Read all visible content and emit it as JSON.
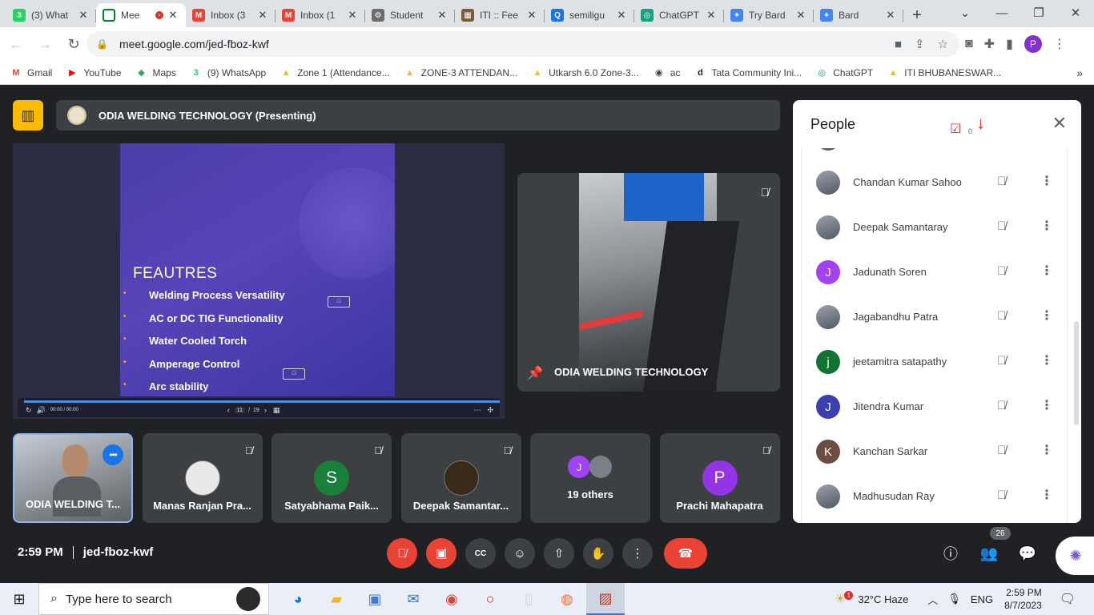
{
  "browser": {
    "tabs": [
      {
        "label": "(3) What",
        "icon": "whatsapp-icon",
        "color": "#25d366",
        "badge": "3"
      },
      {
        "label": "Mee",
        "icon": "meet-icon",
        "color": "#00832d",
        "active": true,
        "recording": true
      },
      {
        "label": "Inbox (3",
        "icon": "gmail-icon",
        "color": "#ea4335",
        "badge": "M"
      },
      {
        "label": "Inbox (1",
        "icon": "gmail-icon",
        "color": "#ea4335",
        "badge": "M"
      },
      {
        "label": "Student",
        "icon": "seal-icon",
        "color": "#6d6d6d",
        "badge": "⚙"
      },
      {
        "label": "ITI :: Fee",
        "icon": "iti-icon",
        "color": "#7a5c3a",
        "badge": "▦"
      },
      {
        "label": "semiligu",
        "icon": "search-icon",
        "color": "#1a73e8",
        "badge": "Q"
      },
      {
        "label": "ChatGPT",
        "icon": "chatgpt-icon",
        "color": "#10a37f",
        "badge": "◎"
      },
      {
        "label": "Try Bard",
        "icon": "bard-icon",
        "color": "#4285f4",
        "badge": "✦"
      },
      {
        "label": "Bard",
        "icon": "bard-icon",
        "color": "#4285f4",
        "badge": "✦"
      }
    ],
    "url": "meet.google.com/jed-fboz-kwf",
    "profile_initial": "P",
    "bookmarks": [
      {
        "label": "Gmail",
        "badge": "M",
        "color": "#ea4335"
      },
      {
        "label": "YouTube",
        "badge": "▶",
        "color": "#ff0000"
      },
      {
        "label": "Maps",
        "badge": "◆",
        "color": "#34a853"
      },
      {
        "label": "(9) WhatsApp",
        "badge": "3",
        "color": "#25d366"
      },
      {
        "label": "Zone 1 (Attendance...",
        "badge": "▲",
        "color": "#fbbc04"
      },
      {
        "label": "ZONE-3 ATTENDAN...",
        "badge": "▲",
        "color": "#fbbc04"
      },
      {
        "label": "Utkarsh 6.0 Zone-3...",
        "badge": "▲",
        "color": "#fbbc04"
      },
      {
        "label": "ac",
        "badge": "◉",
        "color": "#3c4043"
      },
      {
        "label": "Tata Community Ini...",
        "badge": "d",
        "color": "#202124"
      },
      {
        "label": "ChatGPT",
        "badge": "◎",
        "color": "#10a37f"
      },
      {
        "label": "ITI BHUBANESWAR...",
        "badge": "▲",
        "color": "#fbbc04"
      }
    ]
  },
  "meet": {
    "presenting_label": "ODIA WELDING TECHNOLOGY (Presenting)",
    "slide": {
      "title": "FEAUTRES",
      "bullets": [
        "Welding Process Versatility",
        "AC or DC TIG Functionality",
        "Water Cooled Torch",
        "Amperage Control",
        "Arc stability"
      ],
      "player_time": "00:00 / 00:00",
      "page_current": "11",
      "page_sep": "/",
      "page_total": "19",
      "progress": 1.0
    },
    "pinned_name": "ODIA WELDING TECHNOLOGY",
    "tiles": [
      {
        "name": "ODIA WELDING T...",
        "type": "self"
      },
      {
        "name": "Manas Ranjan Pra...",
        "type": "photo",
        "color": "#e8e8e8"
      },
      {
        "name": "Satyabhama Paik...",
        "type": "letter",
        "letter": "S",
        "color": "#188038"
      },
      {
        "name": "Deepak Samantar...",
        "type": "photo",
        "color": "#3a2a1a"
      },
      {
        "name": "19 others",
        "type": "others",
        "letter": "J",
        "color": "#a142f4"
      },
      {
        "name": "Prachi Mahapatra",
        "type": "letter",
        "letter": "P",
        "color": "#9334e6"
      }
    ],
    "time": "2:59 PM",
    "meeting_code": "jed-fboz-kwf",
    "participant_count": "26",
    "colors": {
      "end_call": "#ea4335",
      "muted": "#ea4335",
      "accent": "#8ab4f8"
    }
  },
  "people_panel": {
    "title": "People",
    "task_count": "0",
    "people": [
      {
        "name": "Chandan Kumar Sahoo",
        "avatar": "photo"
      },
      {
        "name": "Deepak Samantaray",
        "avatar": "photo"
      },
      {
        "name": "Jadunath Soren",
        "letter": "J",
        "color": "#a142f4"
      },
      {
        "name": "Jagabandhu Patra",
        "avatar": "photo"
      },
      {
        "name": "jeetamitra satapathy",
        "letter": "j",
        "color": "#137333"
      },
      {
        "name": "Jitendra Kumar",
        "letter": "J",
        "color": "#3c3fae"
      },
      {
        "name": "Kanchan Sarkar",
        "letter": "K",
        "color": "#6d4c41"
      },
      {
        "name": "Madhusudan Ray",
        "avatar": "photo"
      }
    ]
  },
  "taskbar": {
    "search_placeholder": "Type here to search",
    "weather": "32°C  Haze",
    "weather_badge": "1",
    "language": "ENG",
    "time": "2:59 PM",
    "date": "8/7/2023"
  }
}
